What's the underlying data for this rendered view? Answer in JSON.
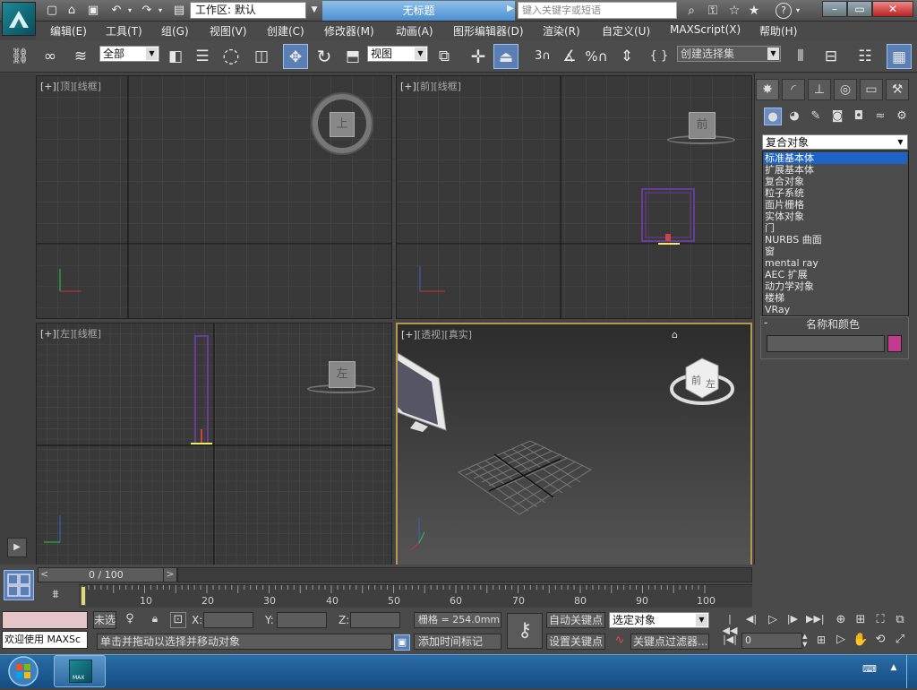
{
  "window": {
    "workspace_label": "工作区: 默认",
    "doc_title": "无标题",
    "search_placeholder": "键入关键字或短语"
  },
  "menu": [
    "编辑(E)",
    "工具(T)",
    "组(G)",
    "视图(V)",
    "创建(C)",
    "修改器(M)",
    "动画(A)",
    "图形编辑器(D)",
    "渲染(R)",
    "自定义(U)",
    "MAXScript(X)",
    "帮助(H)"
  ],
  "toolbar": {
    "filter_select": "全部",
    "ref_coord_select": "视图",
    "named_selection_select": "创建选择集"
  },
  "viewports": {
    "top": {
      "plus": "[+]",
      "name": "[顶]",
      "mode": "[线框]",
      "cube": "上"
    },
    "front": {
      "plus": "[+]",
      "name": "[前]",
      "mode": "[线框]",
      "cube": "前"
    },
    "left": {
      "plus": "[+]",
      "name": "[左]",
      "mode": "[线框]",
      "cube": "左"
    },
    "persp": {
      "plus": "[+]",
      "name": "[透视]",
      "mode": "[真实]",
      "cube_front": "前",
      "cube_left": "左"
    }
  },
  "command_panel": {
    "category_selected": "复合对象",
    "category_options": [
      "标准基本体",
      "扩展基本体",
      "复合对象",
      "粒子系统",
      "面片栅格",
      "实体对象",
      "门",
      "NURBS 曲面",
      "窗",
      "mental ray",
      "AEC 扩展",
      "动力学对象",
      "楼梯",
      "VRay"
    ],
    "name_rollout_title": "名称和颜色",
    "object_color": "#c43a8c"
  },
  "timeline": {
    "frame_display": "0 / 100",
    "ticks": [
      "10",
      "20",
      "30",
      "40",
      "50",
      "60",
      "70",
      "80",
      "90",
      "100"
    ]
  },
  "status": {
    "maxscript_listener": "欢迎使用 MAXSc",
    "selection_state": "未选",
    "x_label": "X:",
    "y_label": "Y:",
    "z_label": "Z:",
    "grid_text": "栅格 = 254.0mm",
    "prompt_text": "单击并拖动以选择并移动对象",
    "add_time_tag": "添加时间标记",
    "auto_key": "自动关键点",
    "set_key": "设置关键点",
    "key_mode_select": "选定对象",
    "key_filters": "关键点过滤器...",
    "current_frame": "0"
  },
  "taskbar": {
    "app_label": "MAX"
  }
}
